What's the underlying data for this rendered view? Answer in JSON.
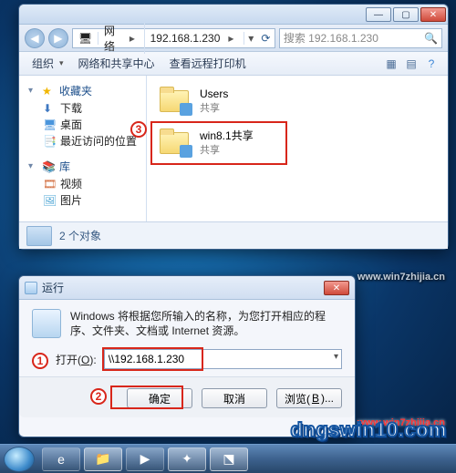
{
  "explorer": {
    "nav_back": "◀",
    "nav_fwd": "▶",
    "crumb_root_icon": "🖥",
    "crumb_root": "网络",
    "crumb_ip": "192.168.1.230",
    "crumb_caret": "▸",
    "search_placeholder": "搜索 192.168.1.230",
    "toolbar": {
      "organize": "组织",
      "network_center": "网络和共享中心",
      "remote_printer": "查看远程打印机"
    },
    "sidebar": {
      "fav": "收藏夹",
      "downloads": "下载",
      "desktop": "桌面",
      "recent": "最近访问的位置",
      "libs": "库",
      "videos": "视频",
      "pictures": "图片"
    },
    "folders": {
      "users_name": "Users",
      "users_sub": "共享",
      "win81_name": "win8.1共享",
      "win81_sub": "共享"
    },
    "callout3": "3",
    "status": "2 个对象"
  },
  "run": {
    "title": "运行",
    "desc": "Windows 将根据您所输入的名称，为您打开相应的程序、文件夹、文档或 Internet 资源。",
    "open_label_pre": "打开(",
    "open_label_u": "O",
    "open_label_post": "):",
    "input_value": "\\\\192.168.1.230",
    "callout1": "1",
    "callout2": "2",
    "ok": "确定",
    "cancel": "取消",
    "browse_pre": "浏览(",
    "browse_u": "B",
    "browse_post": ")..."
  },
  "watermarks": {
    "w1": "www.win7zhijia.cn",
    "w2": "www.win7zhijia.cn",
    "w3": "dngswin10.com"
  }
}
